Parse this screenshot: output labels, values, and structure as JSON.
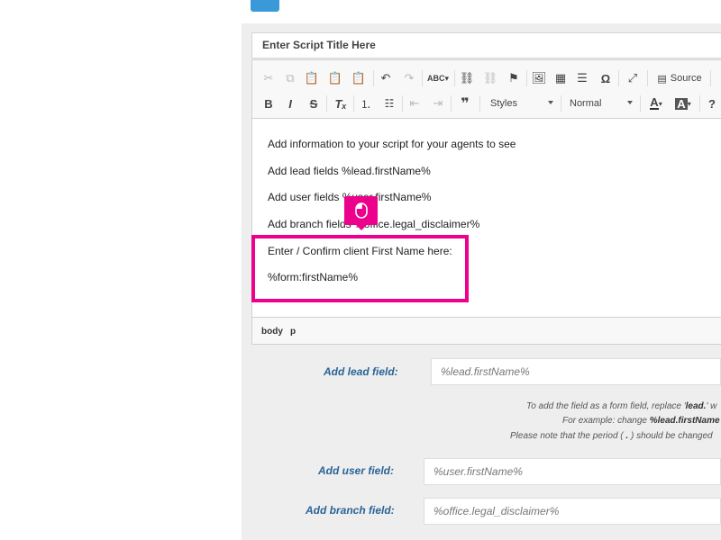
{
  "script_title_placeholder": "Enter Script Title Here",
  "toolbar": {
    "source_label": "Source",
    "styles_label": "Styles",
    "format_label": "Normal"
  },
  "content_lines": [
    "Add information to your script for your agents to see",
    "Add lead fields %lead.firstName%",
    "Add user fields %user.firstName%",
    "Add branch fields %office.legal_disclaimer%",
    "Enter / Confirm client First Name here:",
    "%form:firstName%"
  ],
  "path": {
    "body": "body",
    "p": "p"
  },
  "fields": {
    "lead": {
      "label": "Add lead field:",
      "value": "%lead.firstName%"
    },
    "user": {
      "label": "Add user field:",
      "value": "%user.firstName%"
    },
    "branch": {
      "label": "Add branch field:",
      "value": "%office.legal_disclaimer%"
    }
  },
  "hints": {
    "line1_pre": "To add the field as a form field, replace '",
    "line1_bold": "lead.",
    "line1_post": "' w",
    "line2_pre": "For example: change ",
    "line2_bold": "%lead.firstName",
    "line3_pre": "Please note that the period (",
    "line3_bold": " . ",
    "line3_post": ") should be changed"
  },
  "colors": {
    "highlight": "#ec008c",
    "label_blue": "#2a6496",
    "tab_blue": "#3a9ad9"
  }
}
